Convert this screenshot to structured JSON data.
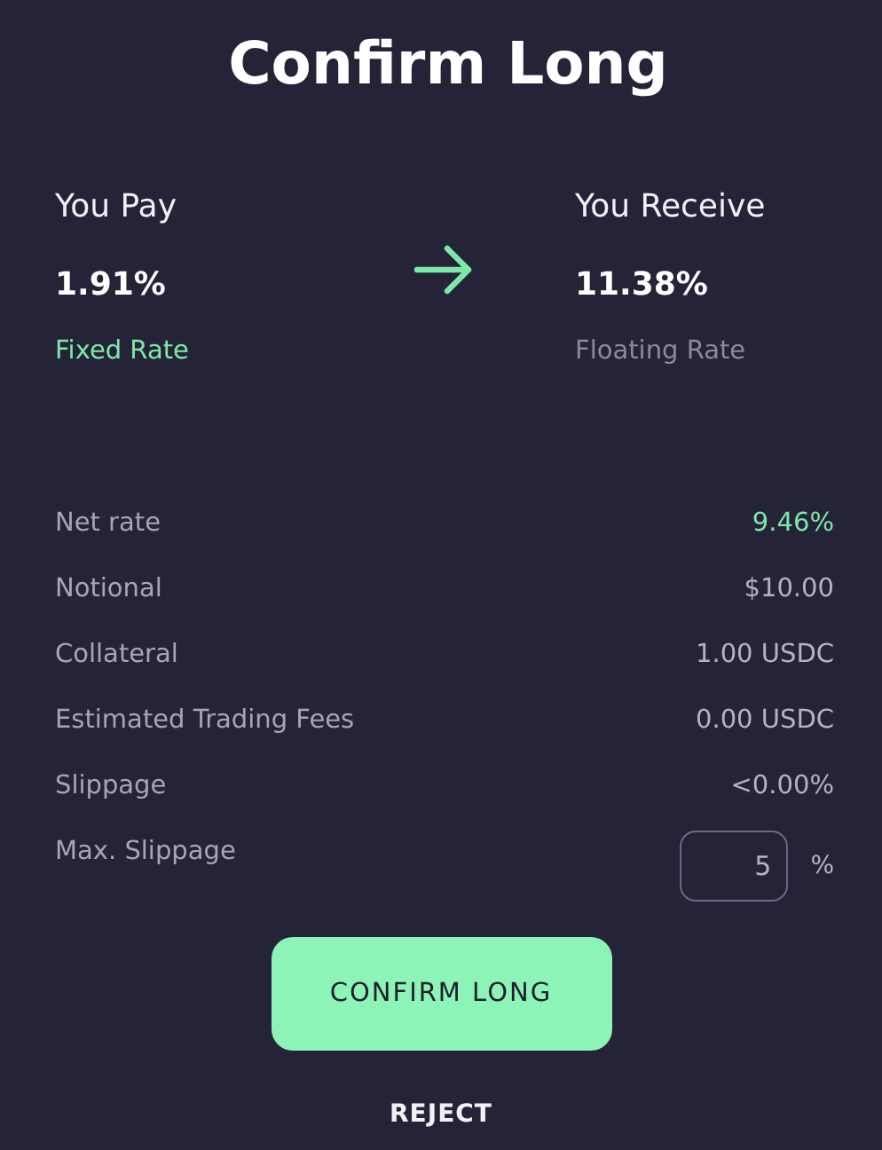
{
  "title": "Confirm Long",
  "sides": [
    {
      "heading": "You Pay",
      "value": "1.91%",
      "rate": "Fixed Rate",
      "highlight": true
    },
    {
      "heading": "You Receive",
      "value": "11.38%",
      "rate": "Floating Rate",
      "highlight": false
    }
  ],
  "details": [
    {
      "label": "Net rate",
      "value": "9.46%",
      "highlight": true
    },
    {
      "label": "Notional",
      "value": "$10.00",
      "highlight": false
    },
    {
      "label": "Collateral",
      "value": "1.00 USDC",
      "highlight": false
    },
    {
      "label": "Estimated Trading Fees",
      "value": "0.00 USDC",
      "highlight": false
    },
    {
      "label": "Slippage",
      "value": "<0.00%",
      "highlight": false
    }
  ],
  "max_slippage": {
    "label": "Max. Slippage",
    "value": "5",
    "unit": "%"
  },
  "buttons": {
    "confirm": "CONFIRM LONG",
    "reject": "REJECT"
  }
}
